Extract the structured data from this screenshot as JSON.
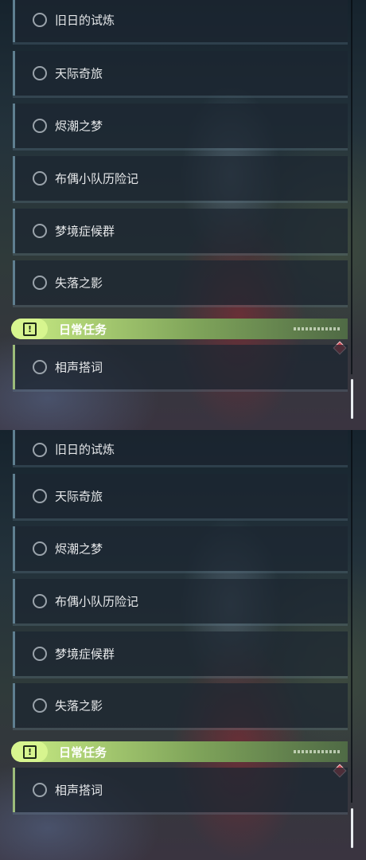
{
  "quest_list": {
    "items": [
      "旧日的试炼",
      "天际奇旅",
      "烬潮之梦",
      "布偶小队历险记",
      "梦境症候群",
      "失落之影"
    ],
    "daily_section": {
      "icon": "exclamation-box-icon",
      "title": "日常任务",
      "items": [
        "相声搭词"
      ]
    }
  },
  "colors": {
    "row_accent": "#5f7f90",
    "daily_accent": "#9cbc7a",
    "header_green": "#c9ec84",
    "badge_red": "#c9424e"
  }
}
